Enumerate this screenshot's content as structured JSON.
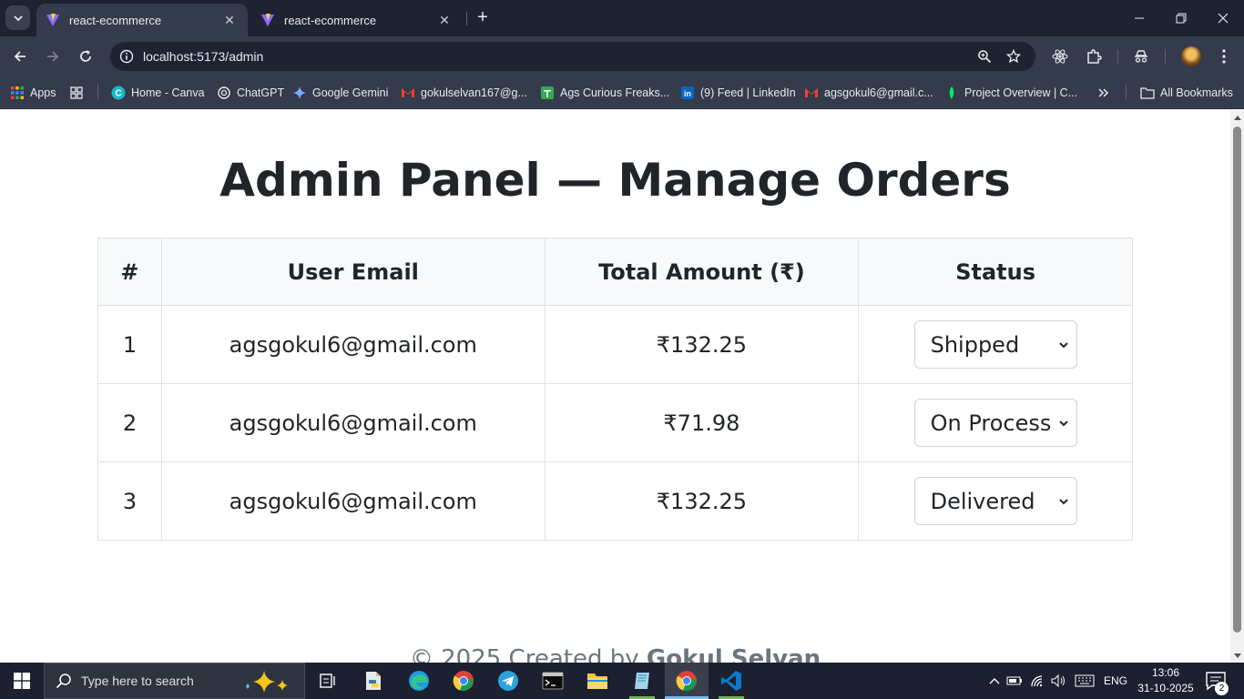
{
  "browser": {
    "tabs": [
      {
        "title": "react-ecommerce",
        "active": true
      },
      {
        "title": "react-ecommerce",
        "active": false
      }
    ],
    "url": {
      "host": "localhost",
      "path": ":5173/admin"
    },
    "bookmarks": [
      {
        "label": "Apps",
        "icon": "apps-grid-icon"
      },
      {
        "label": "Home - Canva",
        "icon": "canva-icon"
      },
      {
        "label": "ChatGPT",
        "icon": "chatgpt-icon"
      },
      {
        "label": "Google Gemini",
        "icon": "gemini-icon"
      },
      {
        "label": "gokulselvan167@g...",
        "icon": "gmail-icon"
      },
      {
        "label": "Ags Curious Freaks...",
        "icon": "sheets-icon"
      },
      {
        "label": "(9) Feed | LinkedIn",
        "icon": "linkedin-icon"
      },
      {
        "label": "agsgokul6@gmail.c...",
        "icon": "gmail-icon"
      },
      {
        "label": "Project Overview | C...",
        "icon": "mongodb-icon"
      }
    ],
    "all_bookmarks_label": "All Bookmarks"
  },
  "page": {
    "title": "Admin Panel — Manage Orders",
    "table": {
      "headers": [
        "#",
        "User Email",
        "Total Amount (₹)",
        "Status"
      ],
      "rows": [
        {
          "num": "1",
          "email": "agsgokul6@gmail.com",
          "amount": "₹132.25",
          "status": "Shipped"
        },
        {
          "num": "2",
          "email": "agsgokul6@gmail.com",
          "amount": "₹71.98",
          "status": "On Process"
        },
        {
          "num": "3",
          "email": "agsgokul6@gmail.com",
          "amount": "₹132.25",
          "status": "Delivered"
        }
      ]
    },
    "footer": {
      "prefix": "© 2025 Created by ",
      "author": "Gokul Selvan"
    }
  },
  "taskbar": {
    "search_placeholder": "Type here to search",
    "language": "ENG",
    "time": "13:06",
    "date": "31-10-2025",
    "notification_count": "2"
  },
  "colors": {
    "chrome_dark": "#1e2331",
    "chrome_toolbar": "#343b4c",
    "text_primary": "#212529",
    "table_border": "#dee2e6",
    "header_bg": "#f8f9fa"
  }
}
